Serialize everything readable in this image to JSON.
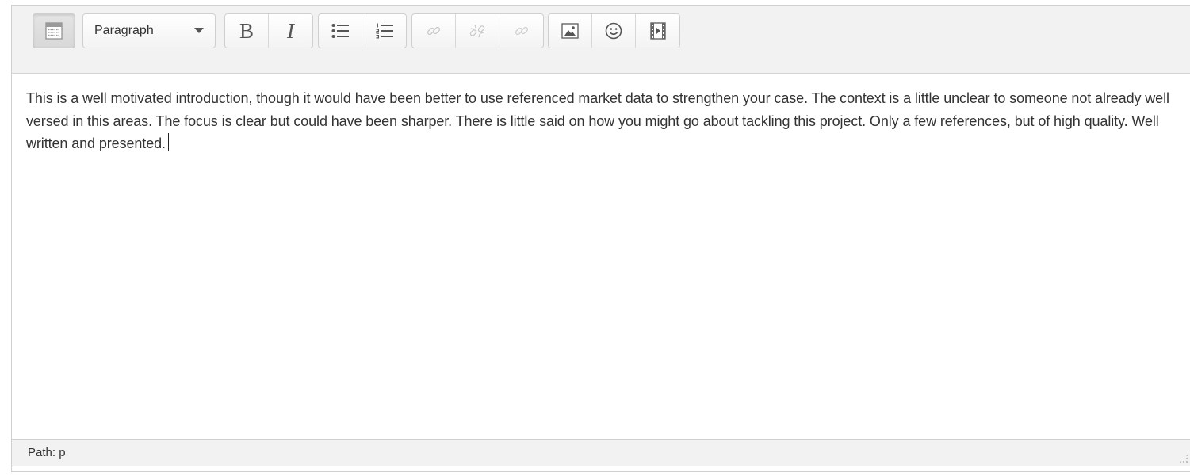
{
  "toolbar": {
    "format_select": {
      "value": "Paragraph"
    },
    "buttons": {
      "bold": "B",
      "italic": "I"
    }
  },
  "content": {
    "text": "This is a well motivated introduction, though it would have been better to use referenced market data to strengthen your case. The context is a little unclear to someone not already well versed in this areas. The focus is clear but could have been sharper. There is little said on how you might go about tackling this project. Only a few references, but of high quality. Well written and presented."
  },
  "statusbar": {
    "path": "Path: p"
  },
  "icons": {
    "toolbar_toggle": "kitchen-sink-icon",
    "dropdown": "chevron-down-icon",
    "bulleted_list": "bullet-list-icon",
    "numbered_list": "numbered-list-icon",
    "link": "link-icon",
    "unlink": "unlink-icon",
    "anchor": "anchor-icon",
    "image": "image-icon",
    "emoticon": "smiley-icon",
    "media": "media-icon"
  }
}
